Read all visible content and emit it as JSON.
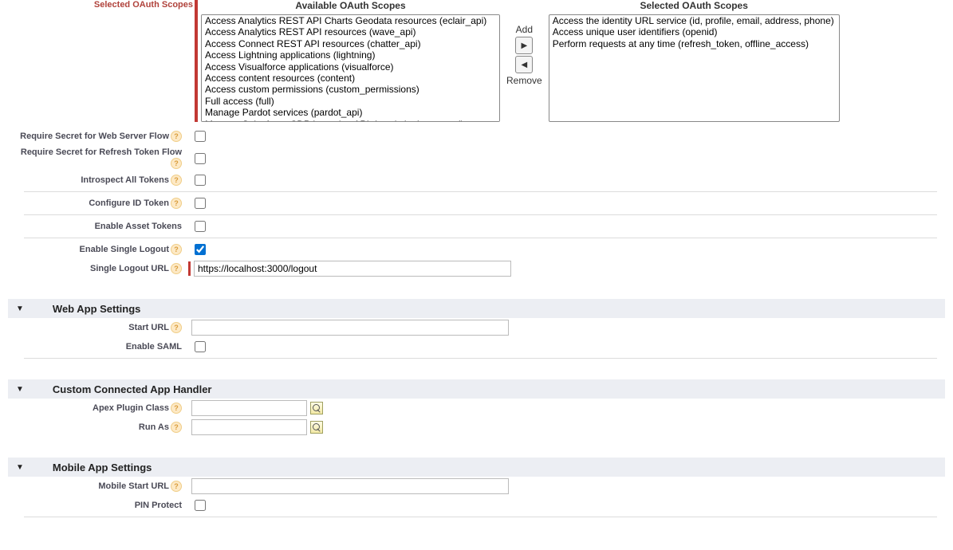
{
  "scopes": {
    "section_label": "Selected OAuth Scopes",
    "available_title": "Available OAuth Scopes",
    "selected_title": "Selected OAuth Scopes",
    "add_label": "Add",
    "remove_label": "Remove",
    "available": [
      "Access Analytics REST API Charts Geodata resources (eclair_api)",
      "Access Analytics REST API resources (wave_api)",
      "Access Connect REST API resources (chatter_api)",
      "Access Lightning applications (lightning)",
      "Access Visualforce applications (visualforce)",
      "Access content resources (content)",
      "Access custom permissions (custom_permissions)",
      "Full access (full)",
      "Manage Pardot services (pardot_api)",
      "Manage Salesforce CDP Ingestion API data (cdp_ingest_api)"
    ],
    "selected": [
      "Access the identity URL service (id, profile, email, address, phone)",
      "Access unique user identifiers (openid)",
      "Perform requests at any time (refresh_token, offline_access)"
    ]
  },
  "oauth_rows": {
    "require_secret_web": "Require Secret for Web Server Flow",
    "require_secret_refresh": "Require Secret for Refresh Token Flow",
    "introspect_all": "Introspect All Tokens",
    "configure_id_token": "Configure ID Token",
    "enable_asset": "Enable Asset Tokens",
    "enable_slo": "Enable Single Logout",
    "slo_url_label": "Single Logout URL",
    "slo_url_value": "https://localhost:3000/logout"
  },
  "sections": {
    "web_app": "Web App Settings",
    "custom_handler": "Custom Connected App Handler",
    "mobile": "Mobile App Settings"
  },
  "web_app": {
    "start_url": "Start URL",
    "enable_saml": "Enable SAML"
  },
  "custom_handler": {
    "apex_class": "Apex Plugin Class",
    "run_as": "Run As"
  },
  "mobile": {
    "start_url": "Mobile Start URL",
    "pin_protect": "PIN Protect"
  }
}
